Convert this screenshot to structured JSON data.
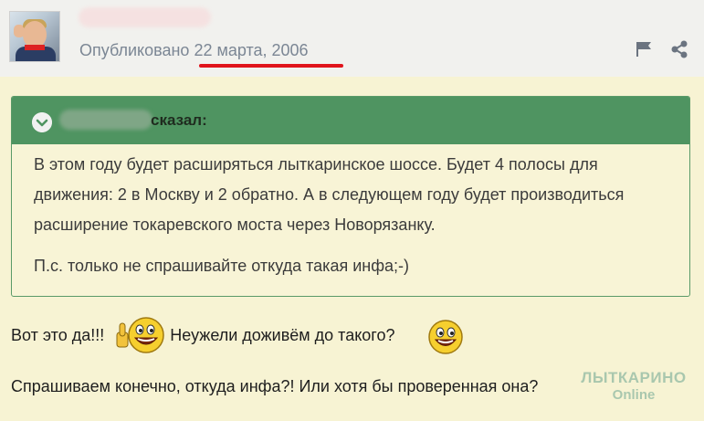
{
  "post": {
    "published_label": "Опубликовано",
    "published_date": "22 марта, 2006"
  },
  "quote": {
    "author_suffix": "сказал:",
    "paragraphs": [
      "В этом году будет расширяться лыткаринское шоссе. Будет 4 полосы для движения: 2 в Москву и 2 обратно. А в следующем году будет производиться расширение токаревского моста через Новорязанку.",
      "П.с. только не спрашивайте откуда такая инфа;-)"
    ]
  },
  "message": {
    "line1_part1": "Вот это да!!!",
    "line1_part2": "Неужели доживём до такого?",
    "line2": "Спрашиваем конечно, откуда инфа?! Или хотя бы проверенная она?"
  },
  "watermark": {
    "line1": "ЛЫТКАРИНО",
    "line2": "Online"
  },
  "icons": {
    "flag": "flag-icon",
    "share": "share-icon",
    "collapse": "chevron-down-icon"
  },
  "colors": {
    "quote_header": "#4f9461",
    "background": "#f7f3d3",
    "underline": "#e0141b"
  }
}
